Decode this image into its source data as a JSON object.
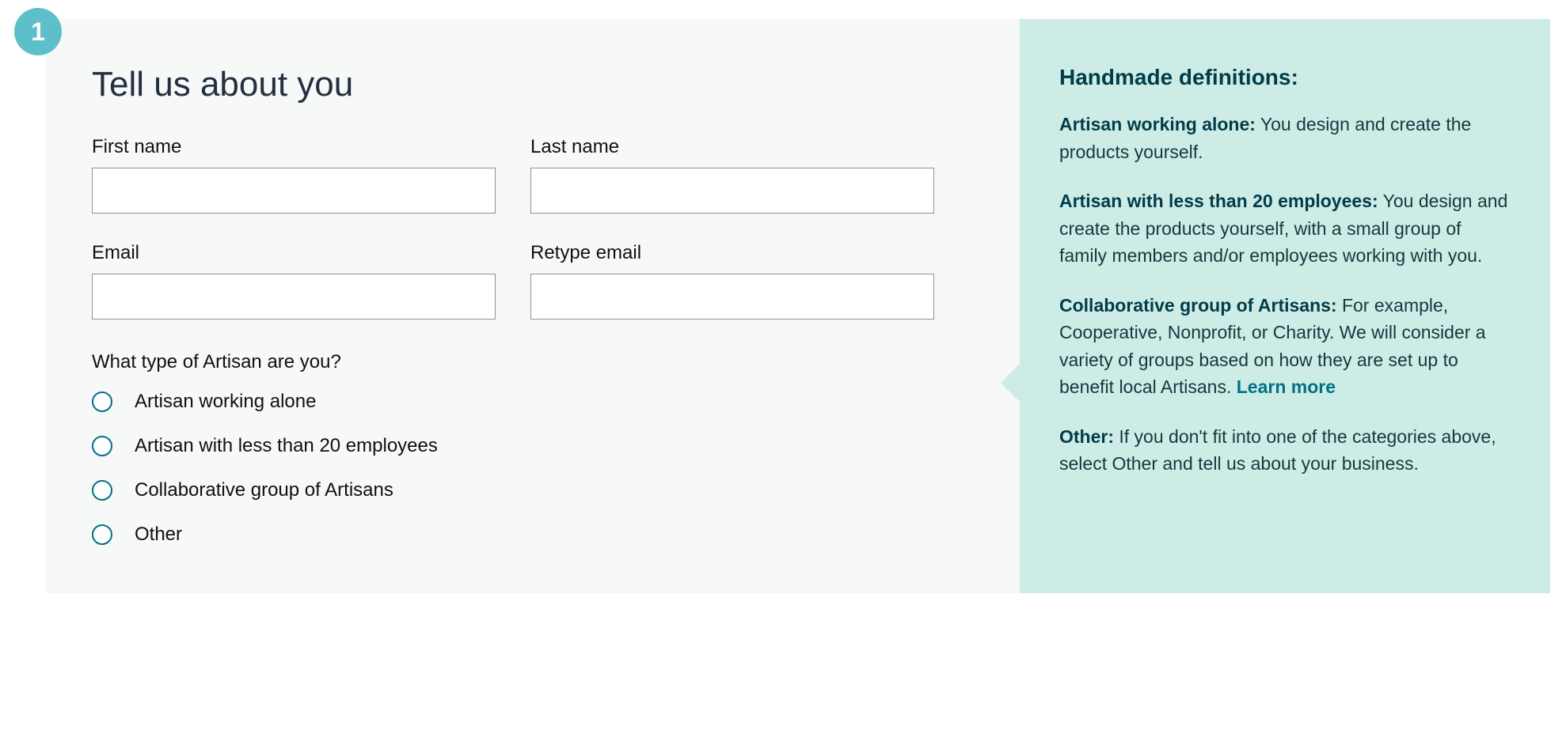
{
  "step_number": "1",
  "form": {
    "title": "Tell us about you",
    "fields": {
      "first_name": {
        "label": "First name",
        "value": ""
      },
      "last_name": {
        "label": "Last name",
        "value": ""
      },
      "email": {
        "label": "Email",
        "value": ""
      },
      "retype_email": {
        "label": "Retype email",
        "value": ""
      }
    },
    "artisan_question": "What type of Artisan are you?",
    "artisan_options": [
      "Artisan working alone",
      "Artisan with less than 20 employees",
      "Collaborative group of Artisans",
      "Other"
    ]
  },
  "definitions": {
    "title": "Handmade definitions:",
    "items": [
      {
        "term": "Artisan working alone:",
        "desc": "  You design and create the products yourself."
      },
      {
        "term": "Artisan with less than 20 employees:",
        "desc": "  You design and create the products yourself, with a small group of family members and/or employees working with you."
      },
      {
        "term": "Collaborative group of Artisans:",
        "desc": "  For example, Cooperative, Nonprofit, or Charity. We will consider a variety of groups based on how they are set up to benefit local Artisans. "
      },
      {
        "term": "Other:",
        "desc": "  If you don't fit into one of the categories above, select Other and tell us about your business."
      }
    ],
    "learn_more": "Learn more"
  }
}
